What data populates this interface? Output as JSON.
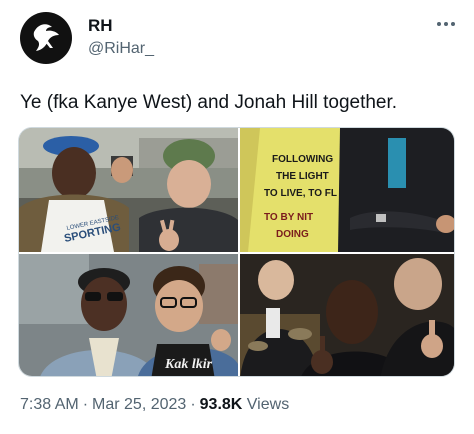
{
  "author": {
    "name": "RH",
    "handle": "@RiHar_"
  },
  "header": {
    "more_icon": "more-horizontal-icon"
  },
  "tweet": {
    "text": "Ye (fka Kanye West) and Jonah Hill together."
  },
  "media": {
    "photos": [
      {
        "shirt_text_1": "LOWER EASTSIDE",
        "shirt_text_2": "SPORTING"
      },
      {
        "shirt_lines": [
          "FOLLOWING",
          "THE LIGHT",
          "TO LIVE, TO FL",
          "TO BY NIT",
          "DOING"
        ]
      },
      {
        "shirt_text": "Kak lkir"
      },
      {}
    ]
  },
  "footer": {
    "time": "7:38 AM",
    "dot1": "·",
    "date": "Mar 25, 2023",
    "dot2": "·",
    "views_count": "93.8K",
    "views_label": "Views"
  },
  "colors": {
    "primary_text": "#0f1419",
    "secondary_text": "#536471",
    "border": "#cfd9de",
    "background": "#ffffff"
  }
}
